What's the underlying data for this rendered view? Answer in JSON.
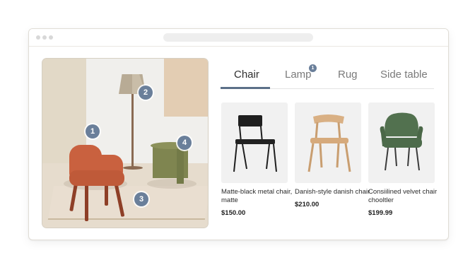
{
  "scene": {
    "hotspots": [
      {
        "number": "1",
        "target": "chair"
      },
      {
        "number": "2",
        "target": "lamp"
      },
      {
        "number": "3",
        "target": "rug"
      },
      {
        "number": "4",
        "target": "side-table"
      }
    ]
  },
  "tabs": [
    {
      "label": "Chair",
      "active": true
    },
    {
      "label": "Lamp",
      "active": false,
      "badge": "1"
    },
    {
      "label": "Rug",
      "active": false
    },
    {
      "label": "Side table",
      "active": false
    }
  ],
  "products": [
    {
      "name": "Matte-black metal chair, matte",
      "price": "$150.00",
      "color": "#1f1f1f"
    },
    {
      "name": "Danish-style danish chair",
      "price": "$210.00",
      "color": "#d9b084"
    },
    {
      "name": "Consiilined velvet chair chooltler",
      "price": "$199.99",
      "color": "#4d6b4b"
    }
  ],
  "colors": {
    "accent": "#5c7088",
    "badge": "#6a7f9a"
  }
}
